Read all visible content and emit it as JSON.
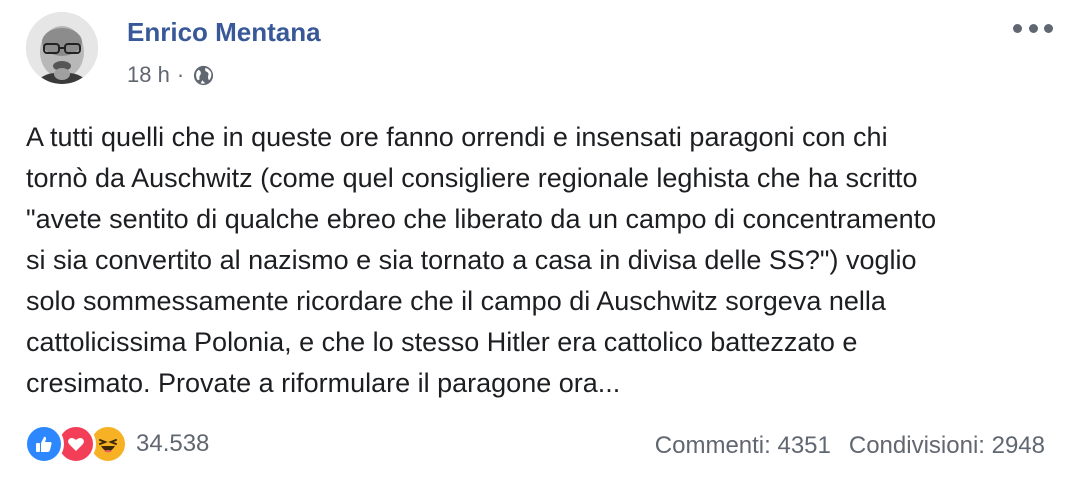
{
  "post": {
    "author": "Enrico Mentana",
    "timestamp": "18 h",
    "separator": "·",
    "audience_icon": "globe-icon",
    "more_icon": "more-options-icon",
    "text": "A tutti quelli che in queste ore fanno orrendi e insensati paragoni con chi\ntornò da Auschwitz (come quel consigliere regionale leghista che ha scritto\n\"avete sentito di qualche ebreo che liberato da un campo di concentramento\nsi sia convertito al nazismo e sia tornato a casa in divisa delle SS?\") voglio\nsolo sommessamente ricordare che il campo di Auschwitz sorgeva nella\ncattolicissima Polonia, e che lo stesso Hitler era cattolico battezzato e\ncresimato. Provate a riformulare il paragone ora..."
  },
  "reactions": {
    "icons": [
      "like-icon",
      "love-icon",
      "haha-icon"
    ],
    "count": "34.538"
  },
  "stats": {
    "comments": "Commenti: 4351",
    "shares": "Condivisioni: 2948"
  },
  "colors": {
    "author": "#385898",
    "meta": "#606770",
    "text": "#1c1e21",
    "like": "#2d88ff",
    "love": "#f33e58",
    "haha": "#f7b125"
  }
}
